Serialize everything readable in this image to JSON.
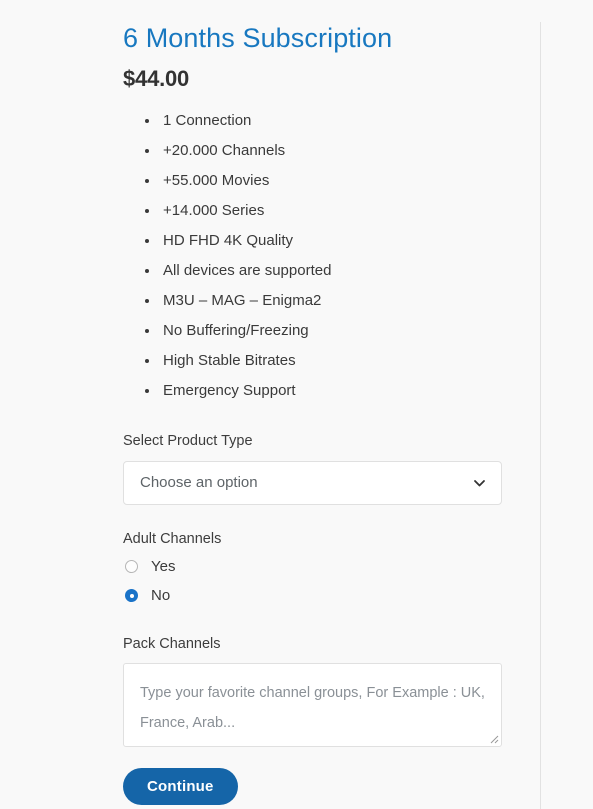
{
  "product": {
    "title": "6 Months Subscription",
    "price": "$44.00",
    "features": [
      "1 Connection",
      "+20.000 Channels",
      "+55.000 Movies",
      "+14.000 Series",
      "HD FHD 4K Quality",
      "All devices are supported",
      "M3U – MAG – Enigma2",
      "No Buffering/Freezing",
      "High Stable Bitrates",
      "Emergency Support"
    ]
  },
  "form": {
    "product_type": {
      "label": "Select Product Type",
      "selected": "Choose an option",
      "icon": "chevron-down-icon"
    },
    "adult_channels": {
      "label": "Adult Channels",
      "options": [
        {
          "label": "Yes",
          "selected": false
        },
        {
          "label": "No",
          "selected": true
        }
      ]
    },
    "pack_channels": {
      "label": "Pack Channels",
      "placeholder": "Type your favorite channel groups, For Example : UK, France, Arab...",
      "value": ""
    },
    "submit_label": "Continue"
  },
  "colors": {
    "title_blue": "#1878c0",
    "button_blue": "#1565a8",
    "radio_blue": "#1a73c8",
    "page_background": "#f9f9f9",
    "divider": "#e2e2e2"
  }
}
